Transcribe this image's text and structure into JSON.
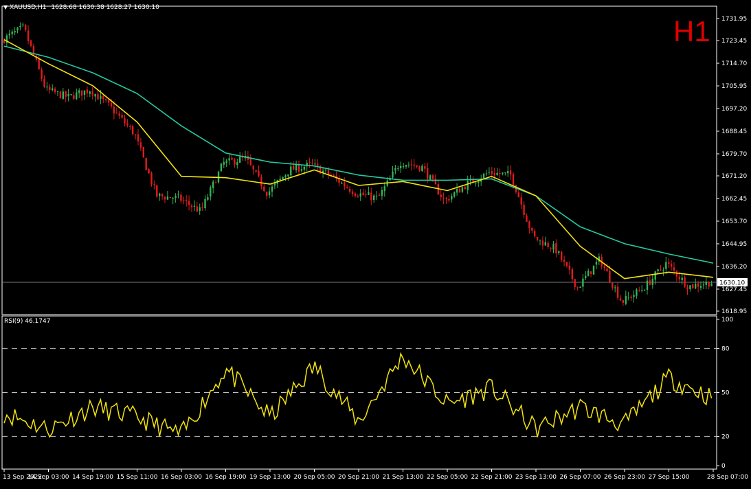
{
  "header": {
    "symbol": "XAUUSD,H1",
    "ohlc": "1628.68 1630.38 1628.27 1630.10",
    "timeframe_badge": "H1",
    "timeframe_badge_color": "#e00000"
  },
  "colors": {
    "background": "#000000",
    "bull_candle": "#34b556",
    "bear_candle": "#e21b1b",
    "ma_fast": "#f2e310",
    "ma_slow": "#24c9a0",
    "rsi_line": "#f2e310",
    "axis": "#ffffff"
  },
  "price_axis": {
    "ticks": [
      "1731.95",
      "1723.45",
      "1714.70",
      "1705.95",
      "1697.20",
      "1688.45",
      "1679.70",
      "1671.20",
      "1662.45",
      "1653.70",
      "1644.95",
      "1636.20",
      "1627.45",
      "1618.95"
    ],
    "current_price_label": "1630.10"
  },
  "rsi": {
    "label": "RSI(9) 46.1747",
    "ticks": [
      "100",
      "80",
      "50",
      "20",
      "0"
    ]
  },
  "time_axis": {
    "labels": [
      "13 Sep 2022",
      "14 Sep 03:00",
      "14 Sep 19:00",
      "15 Sep 11:00",
      "16 Sep 03:00",
      "16 Sep 19:00",
      "19 Sep 13:00",
      "20 Sep 05:00",
      "20 Sep 21:00",
      "21 Sep 13:00",
      "22 Sep 05:00",
      "22 Sep 21:00",
      "23 Sep 13:00",
      "26 Sep 07:00",
      "26 Sep 23:00",
      "27 Sep 15:00",
      "28 Sep 07:00"
    ]
  },
  "chart_data": [
    {
      "type": "candlestick",
      "title": "XAUUSD,H1",
      "ylim": [
        1618.95,
        1731.95
      ],
      "current_price": 1630.1,
      "close_path": [
        {
          "x": "13 Sep 2022",
          "y": 1723.5
        },
        {
          "x": "13 Sep 2022",
          "y": 1728.5
        },
        {
          "x": "14 Sep 03:00",
          "y": 1704.5
        },
        {
          "x": "14 Sep 03:00",
          "y": 1701.5
        },
        {
          "x": "14 Sep 19:00",
          "y": 1704.5
        },
        {
          "x": "14 Sep 19:00",
          "y": 1697.0
        },
        {
          "x": "15 Sep 11:00",
          "y": 1687.5
        },
        {
          "x": "15 Sep 11:00",
          "y": 1663.5
        },
        {
          "x": "16 Sep 03:00",
          "y": 1662.5
        },
        {
          "x": "16 Sep 03:00",
          "y": 1657.5
        },
        {
          "x": "16 Sep 19:00",
          "y": 1676.0
        },
        {
          "x": "16 Sep 19:00",
          "y": 1678.0
        },
        {
          "x": "19 Sep 13:00",
          "y": 1664.5
        },
        {
          "x": "19 Sep 13:00",
          "y": 1673.5
        },
        {
          "x": "20 Sep 05:00",
          "y": 1675.5
        },
        {
          "x": "20 Sep 05:00",
          "y": 1670.5
        },
        {
          "x": "20 Sep 21:00",
          "y": 1664.5
        },
        {
          "x": "20 Sep 21:00",
          "y": 1662.5
        },
        {
          "x": "21 Sep 13:00",
          "y": 1676.5
        },
        {
          "x": "21 Sep 13:00",
          "y": 1674.5
        },
        {
          "x": "22 Sep 05:00",
          "y": 1661.5
        },
        {
          "x": "22 Sep 05:00",
          "y": 1668.0
        },
        {
          "x": "22 Sep 21:00",
          "y": 1672.5
        },
        {
          "x": "22 Sep 21:00",
          "y": 1671.5
        },
        {
          "x": "23 Sep 13:00",
          "y": 1647.5
        },
        {
          "x": "23 Sep 13:00",
          "y": 1643.0
        },
        {
          "x": "26 Sep 07:00",
          "y": 1628.0
        },
        {
          "x": "26 Sep 07:00",
          "y": 1639.0
        },
        {
          "x": "26 Sep 23:00",
          "y": 1622.5
        },
        {
          "x": "26 Sep 23:00",
          "y": 1628.0
        },
        {
          "x": "27 Sep 15:00",
          "y": 1637.5
        },
        {
          "x": "27 Sep 15:00",
          "y": 1628.5
        },
        {
          "x": "28 Sep 07:00",
          "y": 1630.1
        }
      ],
      "ma_fast": [
        {
          "x": "13 Sep 2022",
          "y": 1723.8
        },
        {
          "x": "14 Sep 03:00",
          "y": 1714.5
        },
        {
          "x": "14 Sep 19:00",
          "y": 1706.0
        },
        {
          "x": "15 Sep 11:00",
          "y": 1692.0
        },
        {
          "x": "16 Sep 03:00",
          "y": 1671.0
        },
        {
          "x": "16 Sep 19:00",
          "y": 1670.5
        },
        {
          "x": "19 Sep 13:00",
          "y": 1668.0
        },
        {
          "x": "20 Sep 05:00",
          "y": 1673.5
        },
        {
          "x": "20 Sep 21:00",
          "y": 1667.5
        },
        {
          "x": "21 Sep 13:00",
          "y": 1669.0
        },
        {
          "x": "22 Sep 05:00",
          "y": 1665.5
        },
        {
          "x": "22 Sep 21:00",
          "y": 1671.0
        },
        {
          "x": "23 Sep 13:00",
          "y": 1663.5
        },
        {
          "x": "26 Sep 07:00",
          "y": 1644.0
        },
        {
          "x": "26 Sep 23:00",
          "y": 1631.5
        },
        {
          "x": "27 Sep 15:00",
          "y": 1634.0
        },
        {
          "x": "28 Sep 07:00",
          "y": 1632.0
        }
      ],
      "ma_slow": [
        {
          "x": "13 Sep 2022",
          "y": 1721.3
        },
        {
          "x": "14 Sep 03:00",
          "y": 1717.0
        },
        {
          "x": "14 Sep 19:00",
          "y": 1711.0
        },
        {
          "x": "15 Sep 11:00",
          "y": 1703.0
        },
        {
          "x": "16 Sep 03:00",
          "y": 1690.5
        },
        {
          "x": "16 Sep 19:00",
          "y": 1680.0
        },
        {
          "x": "19 Sep 13:00",
          "y": 1676.5
        },
        {
          "x": "20 Sep 05:00",
          "y": 1675.0
        },
        {
          "x": "20 Sep 21:00",
          "y": 1671.5
        },
        {
          "x": "21 Sep 13:00",
          "y": 1669.5
        },
        {
          "x": "22 Sep 05:00",
          "y": 1669.5
        },
        {
          "x": "22 Sep 21:00",
          "y": 1670.0
        },
        {
          "x": "23 Sep 13:00",
          "y": 1663.5
        },
        {
          "x": "26 Sep 07:00",
          "y": 1651.5
        },
        {
          "x": "26 Sep 23:00",
          "y": 1645.0
        },
        {
          "x": "27 Sep 15:00",
          "y": 1641.0
        },
        {
          "x": "28 Sep 07:00",
          "y": 1637.5
        }
      ]
    },
    {
      "type": "line",
      "title": "RSI(9) 46.1747",
      "ylim": [
        0,
        100
      ],
      "levels": [
        20,
        50,
        80
      ],
      "x": [
        "13 Sep 2022",
        "14 Sep 03:00",
        "14 Sep 19:00",
        "15 Sep 11:00",
        "16 Sep 03:00",
        "16 Sep 19:00",
        "19 Sep 13:00",
        "20 Sep 05:00",
        "20 Sep 21:00",
        "21 Sep 13:00",
        "22 Sep 05:00",
        "22 Sep 21:00",
        "23 Sep 13:00",
        "26 Sep 07:00",
        "26 Sep 23:00",
        "27 Sep 15:00",
        "28 Sep 07:00"
      ],
      "series": [
        {
          "values": [
            36,
            25,
            40,
            33,
            21,
            66,
            33,
            68,
            30,
            75,
            42,
            53,
            25,
            40,
            28,
            60,
            46
          ]
        }
      ]
    }
  ]
}
